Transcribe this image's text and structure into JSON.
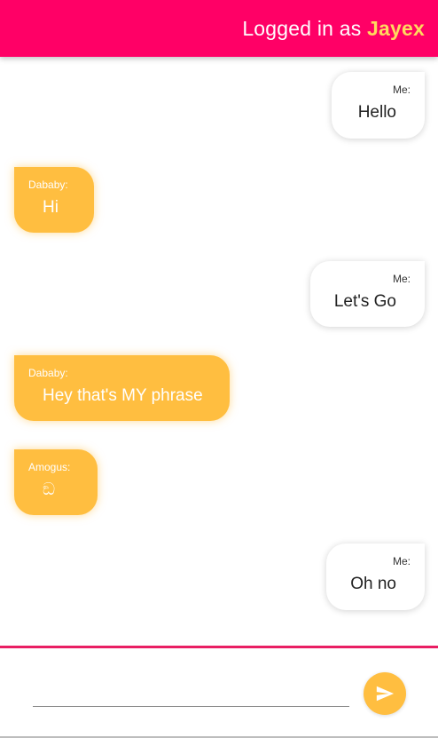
{
  "header": {
    "prefix": "Logged in as",
    "username": "Jayex"
  },
  "messages": [
    {
      "sender": "Me:",
      "text": "Hello",
      "mine": true
    },
    {
      "sender": "Dababy:",
      "text": "Hi",
      "mine": false
    },
    {
      "sender": "Me:",
      "text": "Let's Go",
      "mine": true
    },
    {
      "sender": "Dababy:",
      "text": "Hey that's MY phrase",
      "mine": false
    },
    {
      "sender": "Amogus:",
      "text": "ඞ",
      "mine": false
    },
    {
      "sender": "Me:",
      "text": "Oh no",
      "mine": true
    }
  ],
  "composer": {
    "input_value": "",
    "send_icon": "send-icon"
  },
  "colors": {
    "header": "#ff0066",
    "username": "#ffd95e",
    "other_bubble": "#ffbe40",
    "divider": "#e91e63"
  }
}
